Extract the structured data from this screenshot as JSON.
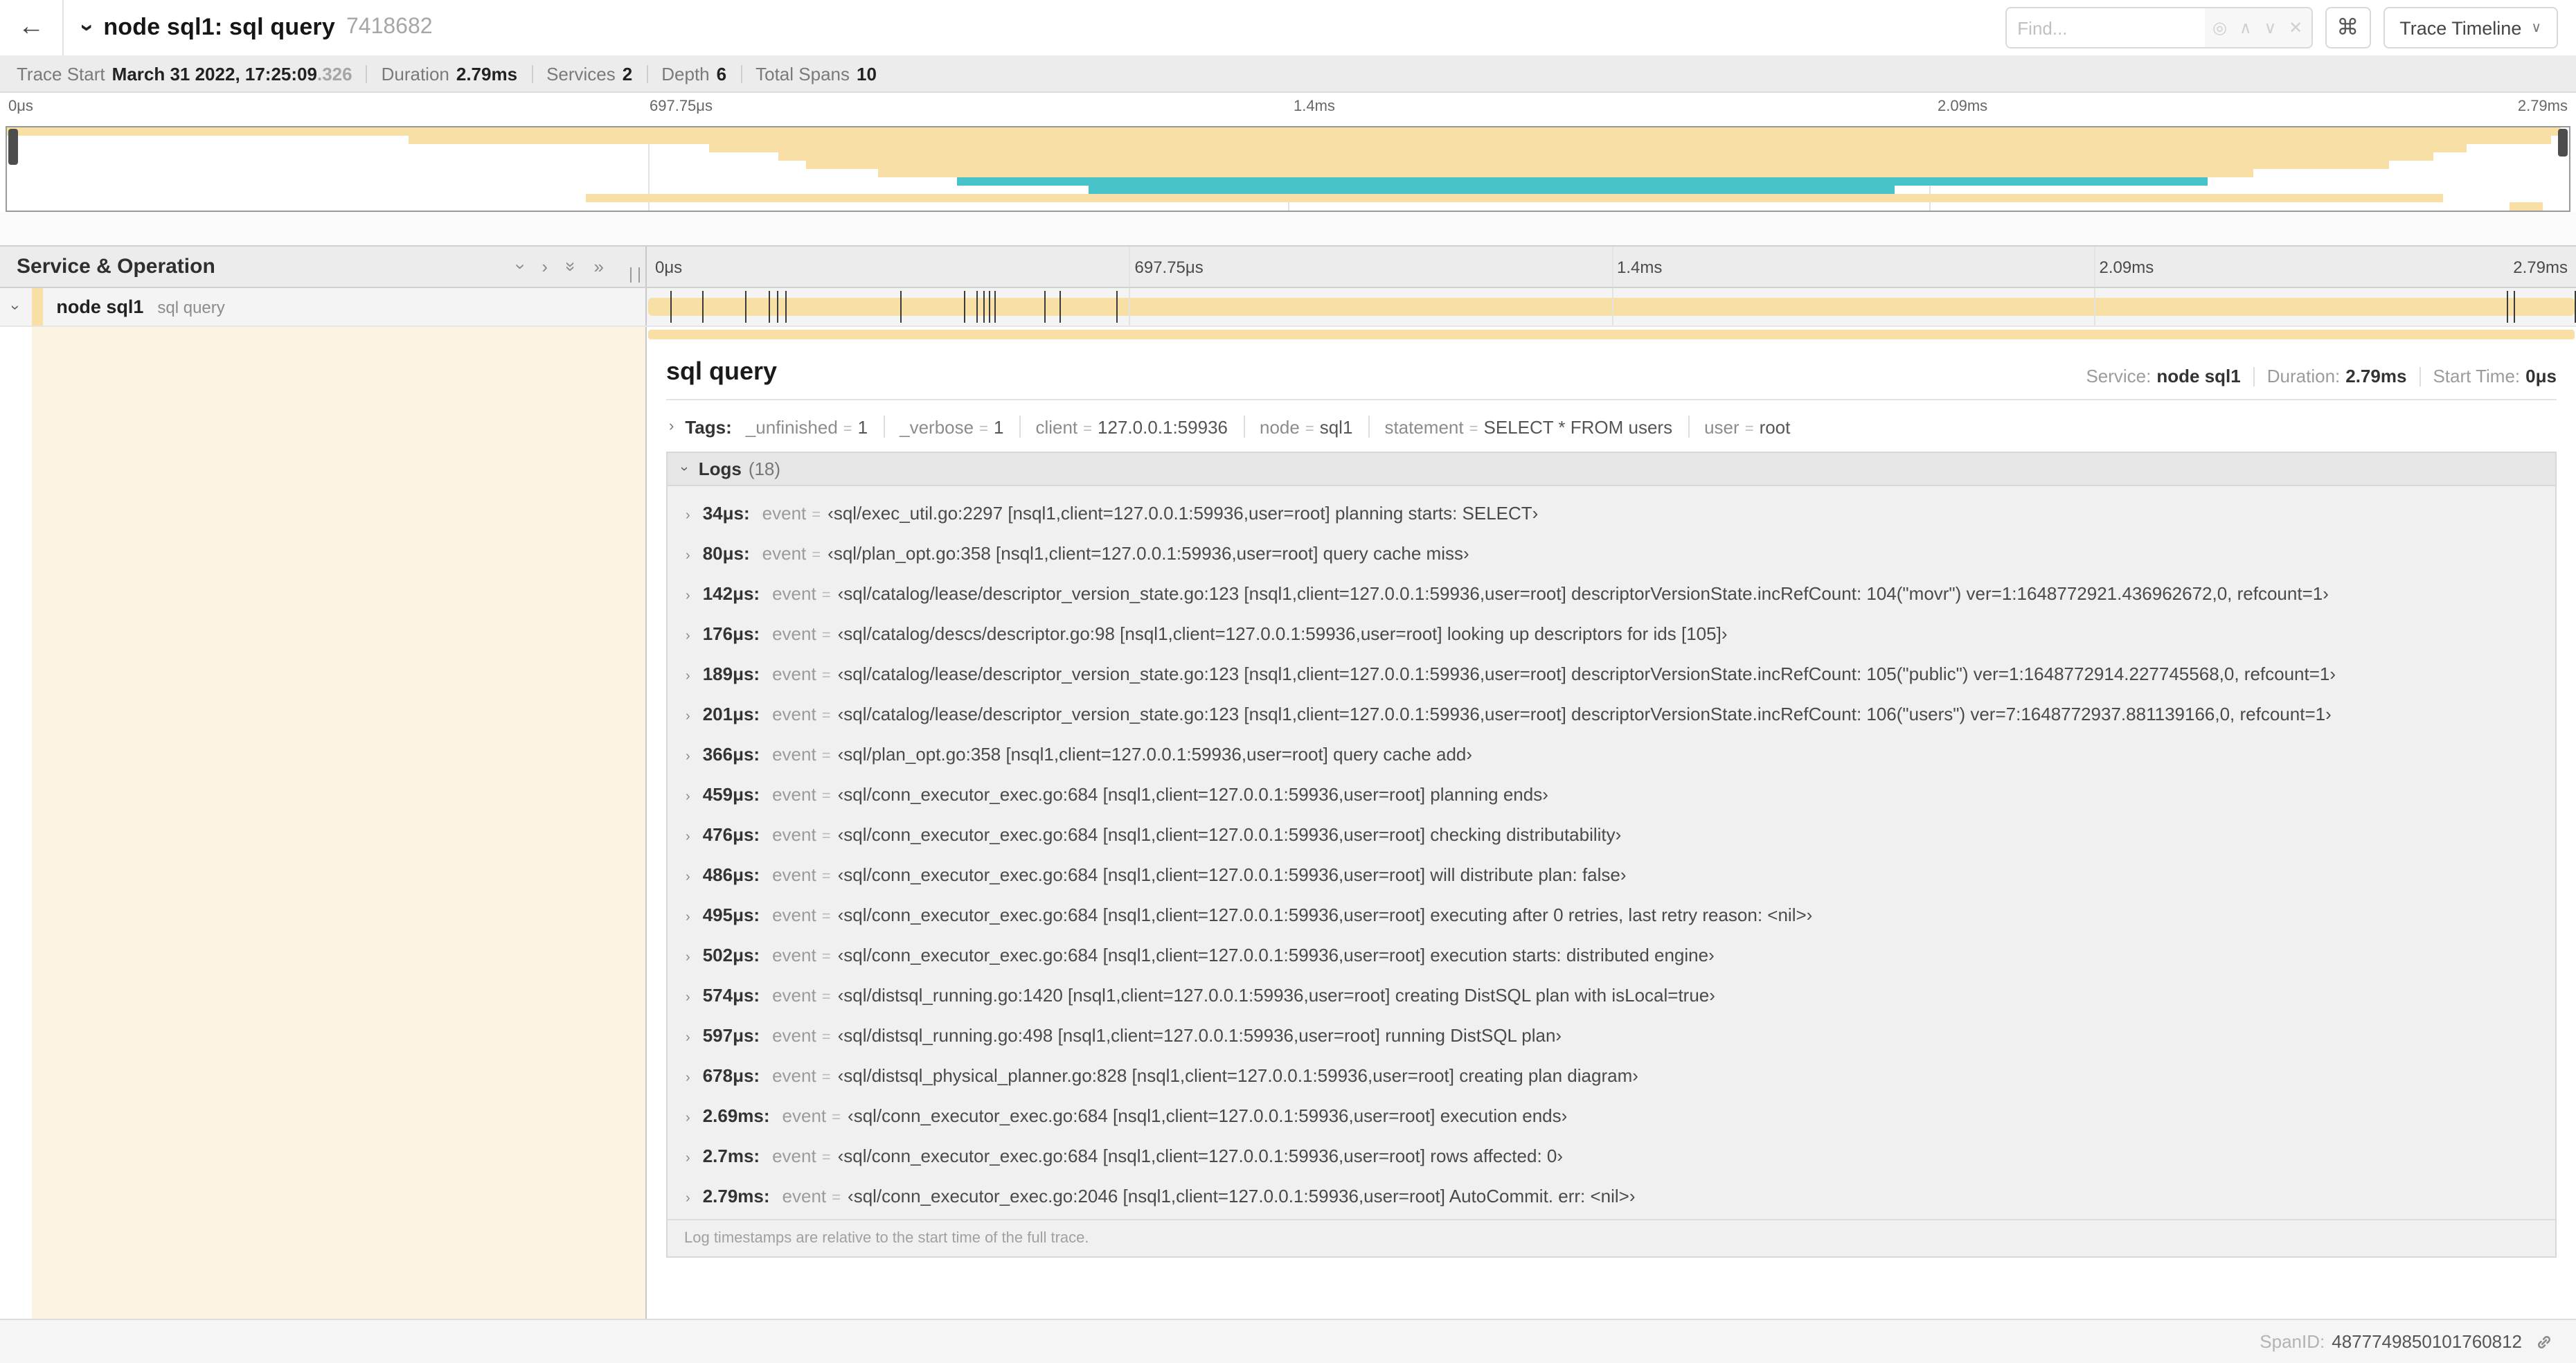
{
  "ui": {
    "back": "←",
    "chevron": "›",
    "double_chevron": "»",
    "up": "∧",
    "down": "∨",
    "clear": "✕",
    "locate": "◎",
    "eq": "="
  },
  "header": {
    "title": "node sql1: sql query",
    "trace_id": "7418682",
    "find_placeholder": "Find...",
    "shortcut": "⌘",
    "view_selector": "Trace Timeline"
  },
  "stats": [
    {
      "label": "Trace Start",
      "value": "March 31 2022, 17:25:09",
      "suffix": ".326"
    },
    {
      "label": "Duration",
      "value": "2.79ms"
    },
    {
      "label": "Services",
      "value": "2"
    },
    {
      "label": "Depth",
      "value": "6"
    },
    {
      "label": "Total Spans",
      "value": "10"
    }
  ],
  "timeline": {
    "left_header": "Service & Operation",
    "duration_us": 2790,
    "ticks": [
      {
        "label": "0μs",
        "pos": 0
      },
      {
        "label": "697.75μs",
        "pos": 25
      },
      {
        "label": "1.4ms",
        "pos": 50
      },
      {
        "label": "2.09ms",
        "pos": 75
      },
      {
        "label": "2.79ms",
        "pos": 100
      }
    ]
  },
  "minimap": {
    "colors": {
      "tan": "#F8DFA6",
      "teal": "#47C3C9"
    },
    "rows": [
      {
        "color": "tan",
        "start": 0.0,
        "end": 0.997
      },
      {
        "color": "tan",
        "start": 0.157,
        "end": 0.993
      },
      {
        "color": "tan",
        "start": 0.274,
        "end": 0.96
      },
      {
        "color": "tan",
        "start": 0.301,
        "end": 0.947
      },
      {
        "color": "tan",
        "start": 0.312,
        "end": 0.93
      },
      {
        "color": "tan",
        "start": 0.34,
        "end": 0.877
      },
      {
        "color": "teal",
        "start": 0.371,
        "end": 0.859
      },
      {
        "color": "teal",
        "start": 0.422,
        "end": 0.737
      },
      {
        "color": "tan",
        "start": 0.226,
        "end": 0.951
      },
      {
        "color": "tan",
        "start": 0.977,
        "end": 0.99
      }
    ]
  },
  "span": {
    "service": "node sql1",
    "operation": "sql query"
  },
  "detail": {
    "title": "sql query",
    "meta": [
      {
        "label": "Service:",
        "value": "node sql1"
      },
      {
        "label": "Duration:",
        "value": "2.79ms"
      },
      {
        "label": "Start Time:",
        "value": "0μs"
      }
    ],
    "tags_label": "Tags:",
    "tags": [
      {
        "key": "_unfinished",
        "value": "1"
      },
      {
        "key": "_verbose",
        "value": "1"
      },
      {
        "key": "client",
        "value": "127.0.0.1:59936"
      },
      {
        "key": "node",
        "value": "sql1"
      },
      {
        "key": "statement",
        "value": "SELECT * FROM users"
      },
      {
        "key": "user",
        "value": "root"
      }
    ],
    "logs_label": "Logs",
    "logs_count": "(18)",
    "logs_key": "event",
    "logs": [
      {
        "t": "34μs:",
        "t_us": 34,
        "value": "‹sql/exec_util.go:2297 [nsql1,client=127.0.0.1:59936,user=root] planning starts: SELECT›"
      },
      {
        "t": "80μs:",
        "t_us": 80,
        "value": "‹sql/plan_opt.go:358 [nsql1,client=127.0.0.1:59936,user=root] query cache miss›"
      },
      {
        "t": "142μs:",
        "t_us": 142,
        "value": "‹sql/catalog/lease/descriptor_version_state.go:123 [nsql1,client=127.0.0.1:59936,user=root] descriptorVersionState.incRefCount: 104(\"movr\") ver=1:1648772921.436962672,0, refcount=1›"
      },
      {
        "t": "176μs:",
        "t_us": 176,
        "value": "‹sql/catalog/descs/descriptor.go:98 [nsql1,client=127.0.0.1:59936,user=root] looking up descriptors for ids [105]›"
      },
      {
        "t": "189μs:",
        "t_us": 189,
        "value": "‹sql/catalog/lease/descriptor_version_state.go:123 [nsql1,client=127.0.0.1:59936,user=root] descriptorVersionState.incRefCount: 105(\"public\") ver=1:1648772914.227745568,0, refcount=1›"
      },
      {
        "t": "201μs:",
        "t_us": 201,
        "value": "‹sql/catalog/lease/descriptor_version_state.go:123 [nsql1,client=127.0.0.1:59936,user=root] descriptorVersionState.incRefCount: 106(\"users\") ver=7:1648772937.881139166,0, refcount=1›"
      },
      {
        "t": "366μs:",
        "t_us": 366,
        "value": "‹sql/plan_opt.go:358 [nsql1,client=127.0.0.1:59936,user=root] query cache add›"
      },
      {
        "t": "459μs:",
        "t_us": 459,
        "value": "‹sql/conn_executor_exec.go:684 [nsql1,client=127.0.0.1:59936,user=root] planning ends›"
      },
      {
        "t": "476μs:",
        "t_us": 476,
        "value": "‹sql/conn_executor_exec.go:684 [nsql1,client=127.0.0.1:59936,user=root] checking distributability›"
      },
      {
        "t": "486μs:",
        "t_us": 486,
        "value": "‹sql/conn_executor_exec.go:684 [nsql1,client=127.0.0.1:59936,user=root] will distribute plan: false›"
      },
      {
        "t": "495μs:",
        "t_us": 495,
        "value": "‹sql/conn_executor_exec.go:684 [nsql1,client=127.0.0.1:59936,user=root] executing after 0 retries, last retry reason: <nil>›"
      },
      {
        "t": "502μs:",
        "t_us": 502,
        "value": "‹sql/conn_executor_exec.go:684 [nsql1,client=127.0.0.1:59936,user=root] execution starts: distributed engine›"
      },
      {
        "t": "574μs:",
        "t_us": 574,
        "value": "‹sql/distsql_running.go:1420 [nsql1,client=127.0.0.1:59936,user=root] creating DistSQL plan with isLocal=true›"
      },
      {
        "t": "597μs:",
        "t_us": 597,
        "value": "‹sql/distsql_running.go:498 [nsql1,client=127.0.0.1:59936,user=root] running DistSQL plan›"
      },
      {
        "t": "678μs:",
        "t_us": 678,
        "value": "‹sql/distsql_physical_planner.go:828 [nsql1,client=127.0.0.1:59936,user=root] creating plan diagram›"
      },
      {
        "t": "2.69ms:",
        "t_us": 2690,
        "value": "‹sql/conn_executor_exec.go:684 [nsql1,client=127.0.0.1:59936,user=root] execution ends›"
      },
      {
        "t": "2.7ms:",
        "t_us": 2700,
        "value": "‹sql/conn_executor_exec.go:684 [nsql1,client=127.0.0.1:59936,user=root] rows affected: 0›"
      },
      {
        "t": "2.79ms:",
        "t_us": 2790,
        "value": "‹sql/conn_executor_exec.go:2046 [nsql1,client=127.0.0.1:59936,user=root] AutoCommit. err: <nil>›"
      }
    ],
    "footnote": "Log timestamps are relative to the start time of the full trace.",
    "footer": {
      "label": "SpanID:",
      "value": "4877749850101760812"
    }
  }
}
